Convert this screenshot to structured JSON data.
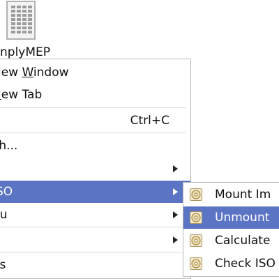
{
  "desktop": {
    "file_label": "nplyMEP",
    "file_icon": "spreadsheet-file-icon"
  },
  "context_menu": {
    "items": [
      {
        "label": "New Window",
        "accel_char": "W"
      },
      {
        "label": "New Tab"
      },
      {
        "label": "",
        "shortcut": "Ctrl+C"
      },
      {
        "label": "ch..."
      },
      {
        "label": "",
        "has_submenu": true
      },
      {
        "label": "ISO",
        "has_submenu": true,
        "highlighted": true
      },
      {
        "label": "nu",
        "has_submenu": true
      },
      {
        "label": "",
        "has_submenu": true
      },
      {
        "label": "es"
      }
    ]
  },
  "iso_submenu": {
    "items": [
      {
        "label": "Mount Im",
        "icon": "disc-image-icon"
      },
      {
        "label": "Unmount",
        "icon": "disc-image-icon",
        "highlighted": true
      },
      {
        "label": "Calculate",
        "icon": "disc-image-icon"
      },
      {
        "label": "Check ISO",
        "icon": "disc-image-icon"
      }
    ]
  },
  "colors": {
    "highlight": "#5b74c4",
    "menu_border": "#b8b8b8",
    "separator": "#dadada"
  }
}
